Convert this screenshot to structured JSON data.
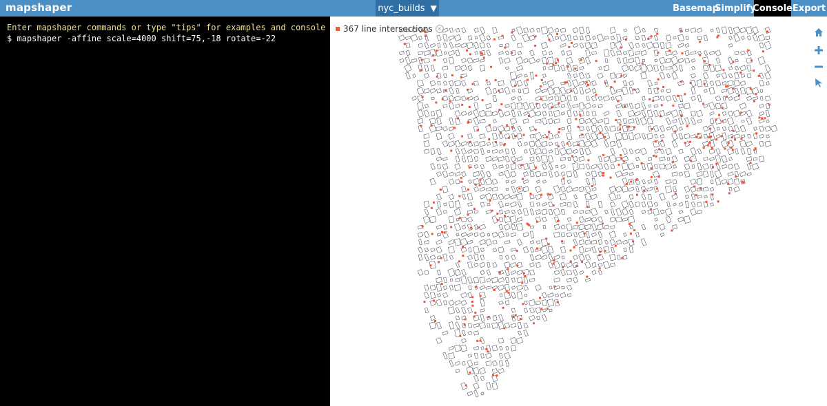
{
  "app": {
    "title": "mapshaper"
  },
  "header": {
    "layer_name": "nyc_builds",
    "menu": [
      "Basemap",
      "Simplify",
      "Console",
      "Export"
    ],
    "active": "Console"
  },
  "console": {
    "message": "Enter mapshaper commands or type \"tips\" for examples and console help",
    "command": "$ mapshaper -affine scale=4000 shift=75,-18 rotate=-22"
  },
  "map": {
    "legend_text": "367 line intersections"
  },
  "colors": {
    "accent": "#4b8fc5",
    "active_tab": "#000000",
    "intersection": "#e8583a",
    "console_message": "#f0e08c"
  },
  "tools": [
    "home-icon",
    "zoom-in-icon",
    "zoom-out-icon",
    "pointer-icon"
  ]
}
